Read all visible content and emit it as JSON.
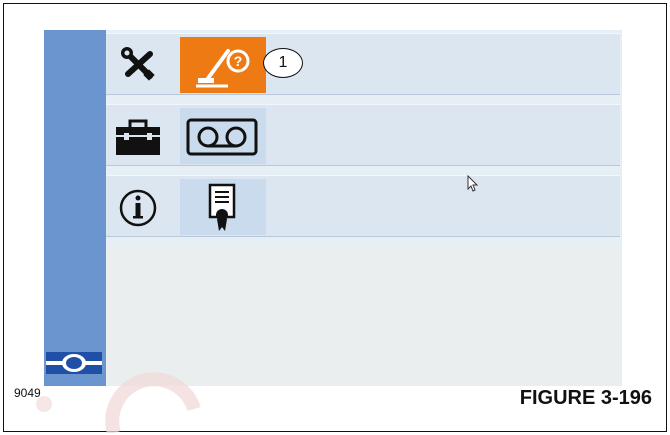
{
  "callout": {
    "number": "1"
  },
  "sidebar": {
    "caption": "9049"
  },
  "labels": {
    "image_id": "9049",
    "figure": "FIGURE 3-196"
  },
  "rows": [
    {
      "category_icon": "tools-icon",
      "tile_icon": "diagnostics-help-icon",
      "active": true
    },
    {
      "category_icon": "toolbox-icon",
      "tile_icon": "tape-recorder-icon",
      "active": false
    },
    {
      "category_icon": "info-icon",
      "tile_icon": "certificate-icon",
      "active": false
    }
  ],
  "colors": {
    "sidebar": "#6a95cf",
    "row": "#dbe6f1",
    "tile": "#c9dbed",
    "active_tile": "#ee7a14"
  }
}
